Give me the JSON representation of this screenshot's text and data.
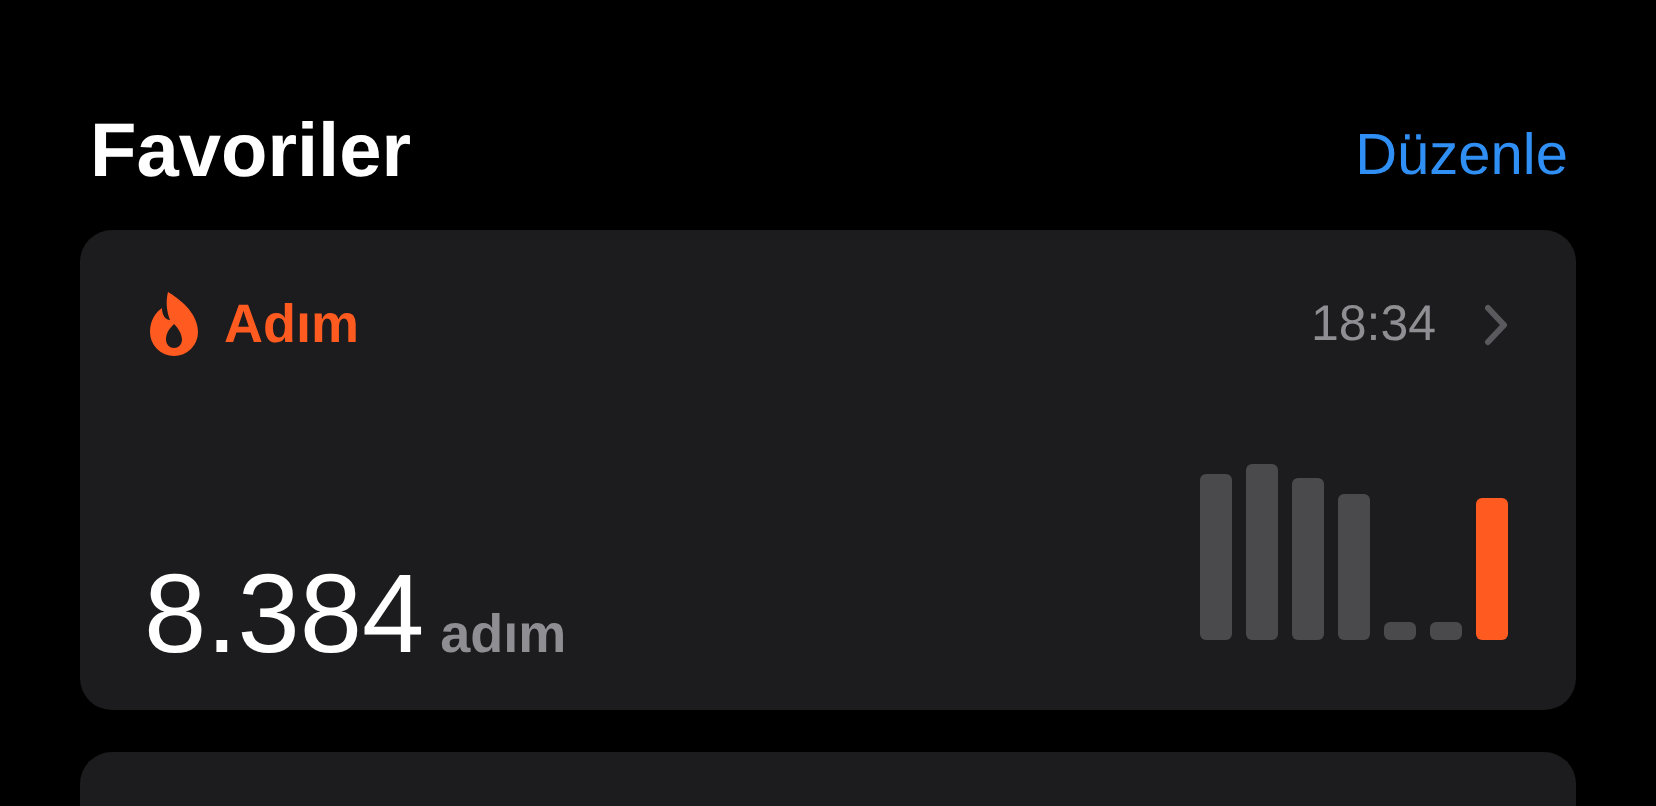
{
  "header": {
    "title": "Favoriler",
    "edit_link": "Düzenle"
  },
  "cards": [
    {
      "kind": "metric",
      "title": "Adım",
      "time": "18:34",
      "value": "8.384",
      "unit": "adım"
    },
    {
      "kind": "partial"
    }
  ]
}
